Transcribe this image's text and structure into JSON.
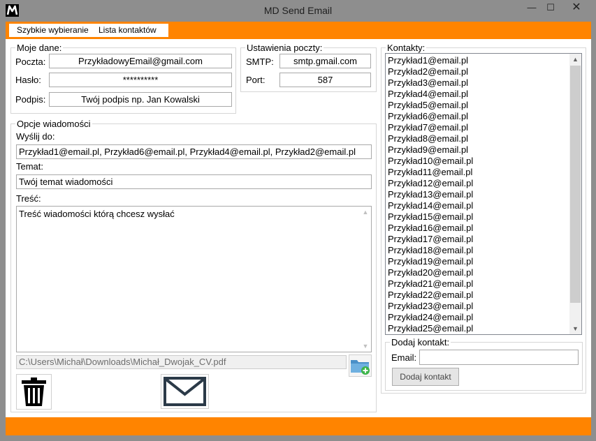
{
  "window": {
    "title": "MD Send Email",
    "logo_letter": "M",
    "minimize_glyph": "—",
    "maximize_glyph": "☐",
    "close_glyph": "✕"
  },
  "menu": {
    "items": [
      "Szybkie wybieranie",
      "Lista kontaktów"
    ]
  },
  "my_data": {
    "group_title": "Moje dane:",
    "email_label": "Poczta:",
    "email_value": "PrzykładowyEmail@gmail.com",
    "password_label": "Hasło:",
    "password_value": "**********",
    "signature_label": "Podpis:",
    "signature_value": "Twój podpis np. Jan Kowalski"
  },
  "mail_settings": {
    "group_title": "Ustawienia poczty:",
    "smtp_label": "SMTP:",
    "smtp_value": "smtp.gmail.com",
    "port_label": "Port:",
    "port_value": "587"
  },
  "message": {
    "group_title": "Opcje wiadomości",
    "to_label": "Wyślij do:",
    "to_value": "Przykład1@email.pl, Przykład6@email.pl, Przykład4@email.pl, Przykład2@email.pl",
    "subject_label": "Temat:",
    "subject_value": "Twój temat wiadomości",
    "body_label": "Treść:",
    "body_value": "Treść wiadomości którą chcesz wysłać",
    "attachment_path": "C:\\Users\\Michał\\Downloads\\Michał_Dwojak_CV.pdf",
    "attach_icon": "folder-add-icon",
    "delete_icon": "trash-icon",
    "send_icon": "envelope-icon"
  },
  "contacts": {
    "group_title": "Kontakty:",
    "items": [
      "Przykład1@email.pl",
      "Przykład2@email.pl",
      "Przykład3@email.pl",
      "Przykład4@email.pl",
      "Przykład5@email.pl",
      "Przykład6@email.pl",
      "Przykład7@email.pl",
      "Przykład8@email.pl",
      "Przykład9@email.pl",
      "Przykład10@email.pl",
      "Przykład11@email.pl",
      "Przykład12@email.pl",
      "Przykład13@email.pl",
      "Przykład14@email.pl",
      "Przykład15@email.pl",
      "Przykład16@email.pl",
      "Przykład17@email.pl",
      "Przykład18@email.pl",
      "Przykład19@email.pl",
      "Przykład20@email.pl",
      "Przykład21@email.pl",
      "Przykład22@email.pl",
      "Przykład23@email.pl",
      "Przykład24@email.pl",
      "Przykład25@email.pl"
    ]
  },
  "add_contact": {
    "group_title": "Dodaj kontakt:",
    "email_label": "Email:",
    "email_value": "",
    "button_label": "Dodaj kontakt"
  },
  "colors": {
    "accent": "#ff8400",
    "titlebar": "#8e8e8e",
    "icon_dark": "#2b3a48",
    "folder_blue": "#4a90c8",
    "plus_green": "#3cb44a"
  }
}
